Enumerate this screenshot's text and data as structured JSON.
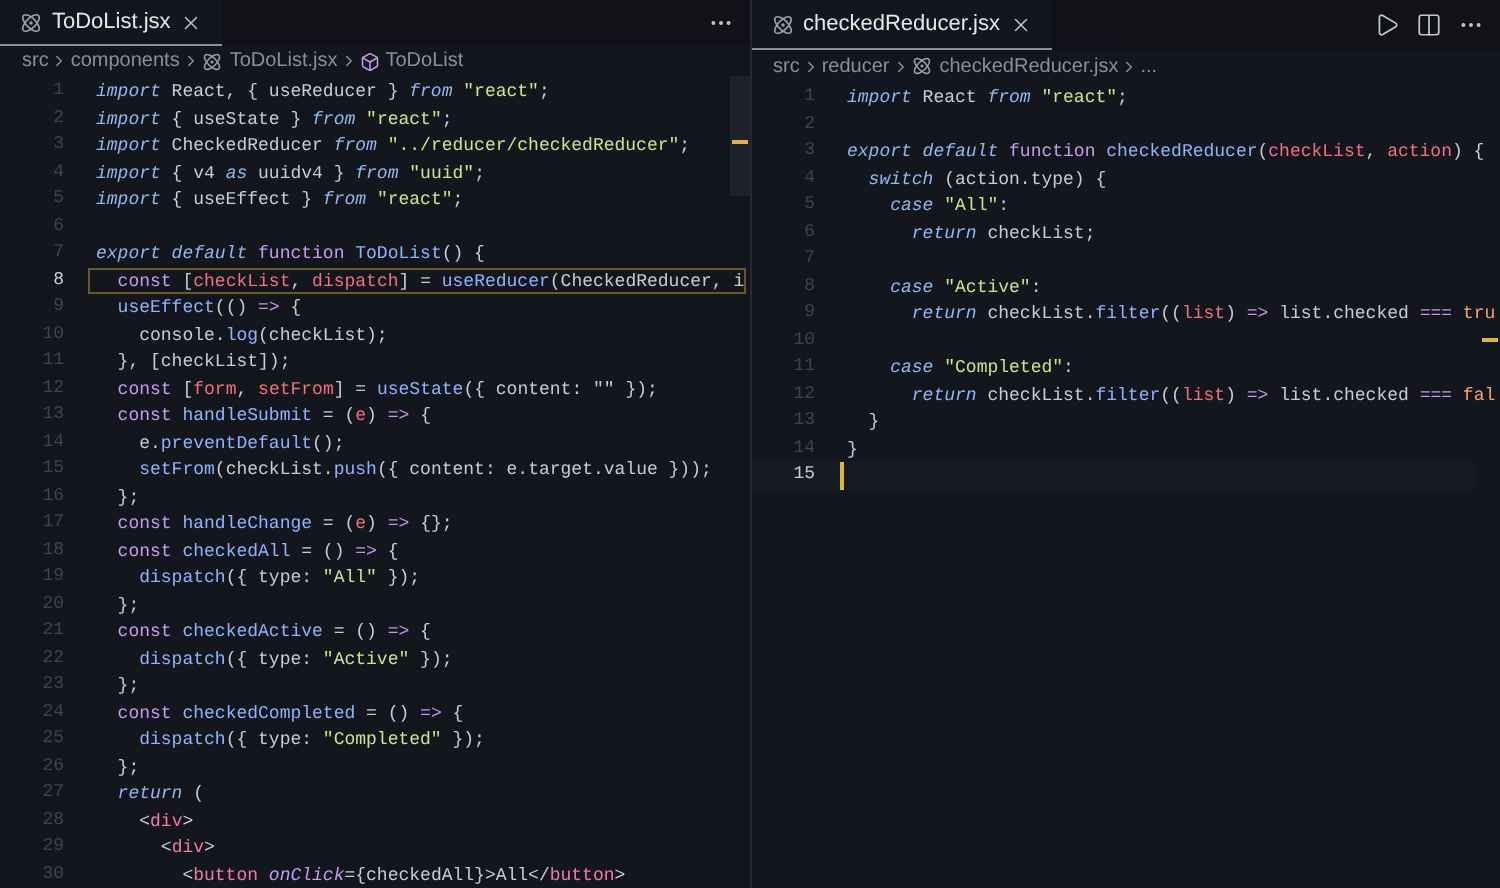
{
  "panes": [
    {
      "tab": {
        "label": "ToDoList.jsx",
        "selected": true
      },
      "breadcrumb": [
        {
          "text": "src",
          "kind": "folder"
        },
        {
          "text": "components",
          "kind": "folder"
        },
        {
          "text": "ToDoList.jsx",
          "kind": "file"
        },
        {
          "text": "ToDoList",
          "kind": "symbol"
        }
      ],
      "lines": [
        {
          "n": "1",
          "current": false,
          "tokens": [
            {
              "text": "import",
              "kind": "kw"
            },
            {
              "text": " React, { useReducer }",
              "kind": "p"
            },
            {
              "text": " from",
              "kind": "kw"
            },
            {
              "text": " \"react\"",
              "kind": "str"
            },
            {
              "text": ";",
              "kind": "p"
            }
          ]
        },
        {
          "n": "2",
          "current": false,
          "tokens": [
            {
              "text": "import",
              "kind": "kw"
            },
            {
              "text": " { useState }",
              "kind": "p"
            },
            {
              "text": " from",
              "kind": "kw"
            },
            {
              "text": " \"react\"",
              "kind": "str"
            },
            {
              "text": ";",
              "kind": "p"
            }
          ]
        },
        {
          "n": "3",
          "current": false,
          "tokens": [
            {
              "text": "import",
              "kind": "kw"
            },
            {
              "text": " CheckedReducer",
              "kind": "p"
            },
            {
              "text": " from",
              "kind": "kw"
            },
            {
              "text": " \"../reducer/checkedReducer\"",
              "kind": "str"
            },
            {
              "text": ";",
              "kind": "p"
            }
          ]
        },
        {
          "n": "4",
          "current": false,
          "tokens": [
            {
              "text": "import",
              "kind": "kw"
            },
            {
              "text": " { v4",
              "kind": "p"
            },
            {
              "text": " as",
              "kind": "kw"
            },
            {
              "text": " uuidv4 }",
              "kind": "p"
            },
            {
              "text": " from",
              "kind": "kw"
            },
            {
              "text": " \"uuid\"",
              "kind": "str"
            },
            {
              "text": ";",
              "kind": "p"
            }
          ]
        },
        {
          "n": "5",
          "current": false,
          "tokens": [
            {
              "text": "import",
              "kind": "kw"
            },
            {
              "text": " { useEffect }",
              "kind": "p"
            },
            {
              "text": " from",
              "kind": "kw"
            },
            {
              "text": " \"react\"",
              "kind": "str"
            },
            {
              "text": ";",
              "kind": "p"
            }
          ]
        },
        {
          "n": "6",
          "current": false
        },
        {
          "n": "7",
          "current": false,
          "tokens": [
            {
              "text": "export default",
              "kind": "kw"
            },
            {
              "text": " function",
              "kind": "fn"
            },
            {
              "text": " ToDoList",
              "kind": "call"
            },
            {
              "text": "() {",
              "kind": "p"
            }
          ]
        },
        {
          "n": "8",
          "current": true,
          "tokens": [
            {
              "text": "  const",
              "kind": "fn"
            },
            {
              "text": " [",
              "kind": "p"
            },
            {
              "text": "checkList",
              "kind": "var"
            },
            {
              "text": ", ",
              "kind": "p"
            },
            {
              "text": "dispatch",
              "kind": "var"
            },
            {
              "text": "] = ",
              "kind": "p"
            },
            {
              "text": "useReducer",
              "kind": "call"
            },
            {
              "text": "(CheckedReducer, i",
              "kind": "p"
            }
          ]
        },
        {
          "n": "9",
          "current": false,
          "tokens": [
            {
              "text": "  useEffect",
              "kind": "call"
            },
            {
              "text": "(() ",
              "kind": "p"
            },
            {
              "text": "=>",
              "kind": "op"
            },
            {
              "text": " {",
              "kind": "p"
            }
          ]
        },
        {
          "n": "10",
          "current": false,
          "tokens": [
            {
              "text": "    console.",
              "kind": "p"
            },
            {
              "text": "log",
              "kind": "call"
            },
            {
              "text": "(checkList);",
              "kind": "p"
            }
          ]
        },
        {
          "n": "11",
          "current": false,
          "tokens": [
            {
              "text": "  }, [checkList]);",
              "kind": "p"
            }
          ]
        },
        {
          "n": "12",
          "current": false,
          "tokens": [
            {
              "text": "  const",
              "kind": "fn"
            },
            {
              "text": " [",
              "kind": "p"
            },
            {
              "text": "form",
              "kind": "var"
            },
            {
              "text": ", ",
              "kind": "p"
            },
            {
              "text": "setFrom",
              "kind": "var"
            },
            {
              "text": "] = ",
              "kind": "p"
            },
            {
              "text": "useState",
              "kind": "call"
            },
            {
              "text": "({ content: \"\" });",
              "kind": "p"
            }
          ]
        },
        {
          "n": "13",
          "current": false,
          "tokens": [
            {
              "text": "  const",
              "kind": "fn"
            },
            {
              "text": " handleSubmit",
              "kind": "call"
            },
            {
              "text": " = (",
              "kind": "p"
            },
            {
              "text": "e",
              "kind": "var"
            },
            {
              "text": ") ",
              "kind": "p"
            },
            {
              "text": "=>",
              "kind": "op"
            },
            {
              "text": " {",
              "kind": "p"
            }
          ]
        },
        {
          "n": "14",
          "current": false,
          "tokens": [
            {
              "text": "    e.",
              "kind": "p"
            },
            {
              "text": "preventDefault",
              "kind": "call"
            },
            {
              "text": "();",
              "kind": "p"
            }
          ]
        },
        {
          "n": "15",
          "current": false,
          "tokens": [
            {
              "text": "    setFrom",
              "kind": "call"
            },
            {
              "text": "(checkList.",
              "kind": "p"
            },
            {
              "text": "push",
              "kind": "call"
            },
            {
              "text": "({ content: e.target.value }));",
              "kind": "p"
            }
          ]
        },
        {
          "n": "16",
          "current": false,
          "tokens": [
            {
              "text": "  };",
              "kind": "p"
            }
          ]
        },
        {
          "n": "17",
          "current": false,
          "tokens": [
            {
              "text": "  const",
              "kind": "fn"
            },
            {
              "text": " handleChange",
              "kind": "call"
            },
            {
              "text": " = (",
              "kind": "p"
            },
            {
              "text": "e",
              "kind": "var"
            },
            {
              "text": ") ",
              "kind": "p"
            },
            {
              "text": "=>",
              "kind": "op"
            },
            {
              "text": " {};",
              "kind": "p"
            }
          ]
        },
        {
          "n": "18",
          "current": false,
          "tokens": [
            {
              "text": "  const",
              "kind": "fn"
            },
            {
              "text": " checkedAll",
              "kind": "call"
            },
            {
              "text": " = () ",
              "kind": "p"
            },
            {
              "text": "=>",
              "kind": "op"
            },
            {
              "text": " {",
              "kind": "p"
            }
          ]
        },
        {
          "n": "19",
          "current": false,
          "tokens": [
            {
              "text": "    dispatch",
              "kind": "call"
            },
            {
              "text": "({ type: ",
              "kind": "p"
            },
            {
              "text": "\"All\"",
              "kind": "str"
            },
            {
              "text": " });",
              "kind": "p"
            }
          ]
        },
        {
          "n": "20",
          "current": false,
          "tokens": [
            {
              "text": "  };",
              "kind": "p"
            }
          ]
        },
        {
          "n": "21",
          "current": false,
          "tokens": [
            {
              "text": "  const",
              "kind": "fn"
            },
            {
              "text": " checkedActive",
              "kind": "call"
            },
            {
              "text": " = () ",
              "kind": "p"
            },
            {
              "text": "=>",
              "kind": "op"
            },
            {
              "text": " {",
              "kind": "p"
            }
          ]
        },
        {
          "n": "22",
          "current": false,
          "tokens": [
            {
              "text": "    dispatch",
              "kind": "call"
            },
            {
              "text": "({ type: ",
              "kind": "p"
            },
            {
              "text": "\"Active\"",
              "kind": "str"
            },
            {
              "text": " });",
              "kind": "p"
            }
          ]
        },
        {
          "n": "23",
          "current": false,
          "tokens": [
            {
              "text": "  };",
              "kind": "p"
            }
          ]
        },
        {
          "n": "24",
          "current": false,
          "tokens": [
            {
              "text": "  const",
              "kind": "fn"
            },
            {
              "text": " checkedCompleted",
              "kind": "call"
            },
            {
              "text": " = () ",
              "kind": "p"
            },
            {
              "text": "=>",
              "kind": "op"
            },
            {
              "text": " {",
              "kind": "p"
            }
          ]
        },
        {
          "n": "25",
          "current": false,
          "tokens": [
            {
              "text": "    dispatch",
              "kind": "call"
            },
            {
              "text": "({ type: ",
              "kind": "p"
            },
            {
              "text": "\"Completed\"",
              "kind": "str"
            },
            {
              "text": " });",
              "kind": "p"
            }
          ]
        },
        {
          "n": "26",
          "current": false,
          "tokens": [
            {
              "text": "  };",
              "kind": "p"
            }
          ]
        },
        {
          "n": "27",
          "current": false,
          "tokens": [
            {
              "text": "  return",
              "kind": "kw"
            },
            {
              "text": " (",
              "kind": "p"
            }
          ]
        },
        {
          "n": "28",
          "current": false,
          "tokens": [
            {
              "text": "    <",
              "kind": "p"
            },
            {
              "text": "div",
              "kind": "tag"
            },
            {
              "text": ">",
              "kind": "p"
            }
          ]
        },
        {
          "n": "29",
          "current": false,
          "tokens": [
            {
              "text": "      <",
              "kind": "p"
            },
            {
              "text": "div",
              "kind": "tag"
            },
            {
              "text": ">",
              "kind": "p"
            }
          ]
        },
        {
          "n": "30",
          "current": false,
          "tokens": [
            {
              "text": "        <",
              "kind": "p"
            },
            {
              "text": "button",
              "kind": "tag"
            },
            {
              "text": " onClick",
              "kind": "attr"
            },
            {
              "text": "={checkedAll}>All</",
              "kind": "p"
            },
            {
              "text": "button",
              "kind": "tag"
            },
            {
              "text": ">",
              "kind": "p"
            }
          ]
        }
      ]
    },
    {
      "tab": {
        "label": "checkedReducer.jsx",
        "selected": true
      },
      "breadcrumb": [
        {
          "text": "src",
          "kind": "folder"
        },
        {
          "text": "reducer",
          "kind": "folder"
        },
        {
          "text": "checkedReducer.jsx",
          "kind": "file"
        },
        {
          "text": "...",
          "kind": "more"
        }
      ],
      "lines": [
        {
          "n": "1",
          "current": false,
          "tokens": [
            {
              "text": "import",
              "kind": "kw"
            },
            {
              "text": " React",
              "kind": "p"
            },
            {
              "text": " from",
              "kind": "kw"
            },
            {
              "text": " \"react\"",
              "kind": "str"
            },
            {
              "text": ";",
              "kind": "p"
            }
          ]
        },
        {
          "n": "2",
          "current": false
        },
        {
          "n": "3",
          "current": false,
          "tokens": [
            {
              "text": "export default",
              "kind": "kw"
            },
            {
              "text": " function",
              "kind": "fn"
            },
            {
              "text": " checkedReducer",
              "kind": "call"
            },
            {
              "text": "(",
              "kind": "p"
            },
            {
              "text": "checkList",
              "kind": "var"
            },
            {
              "text": ", ",
              "kind": "p"
            },
            {
              "text": "action",
              "kind": "var"
            },
            {
              "text": ") {",
              "kind": "p"
            }
          ]
        },
        {
          "n": "4",
          "current": false,
          "tokens": [
            {
              "text": "  switch",
              "kind": "kw"
            },
            {
              "text": " (action.type) {",
              "kind": "p"
            }
          ]
        },
        {
          "n": "5",
          "current": false,
          "tokens": [
            {
              "text": "    case",
              "kind": "kw"
            },
            {
              "text": " \"All\"",
              "kind": "str"
            },
            {
              "text": ":",
              "kind": "p"
            }
          ]
        },
        {
          "n": "6",
          "current": false,
          "tokens": [
            {
              "text": "      return",
              "kind": "kw"
            },
            {
              "text": " checkList;",
              "kind": "p"
            }
          ]
        },
        {
          "n": "7",
          "current": false
        },
        {
          "n": "8",
          "current": false,
          "tokens": [
            {
              "text": "    case",
              "kind": "kw"
            },
            {
              "text": " \"Active\"",
              "kind": "str"
            },
            {
              "text": ":",
              "kind": "p"
            }
          ]
        },
        {
          "n": "9",
          "current": false,
          "tokens": [
            {
              "text": "      return",
              "kind": "kw"
            },
            {
              "text": " checkList.",
              "kind": "p"
            },
            {
              "text": "filter",
              "kind": "call"
            },
            {
              "text": "((",
              "kind": "p"
            },
            {
              "text": "list",
              "kind": "var"
            },
            {
              "text": ") ",
              "kind": "p"
            },
            {
              "text": "=>",
              "kind": "op"
            },
            {
              "text": " list.checked ",
              "kind": "p"
            },
            {
              "text": "===",
              "kind": "op"
            },
            {
              "text": " tru",
              "kind": "bool"
            }
          ]
        },
        {
          "n": "10",
          "current": false
        },
        {
          "n": "11",
          "current": false,
          "tokens": [
            {
              "text": "    case",
              "kind": "kw"
            },
            {
              "text": " \"Completed\"",
              "kind": "str"
            },
            {
              "text": ":",
              "kind": "p"
            }
          ]
        },
        {
          "n": "12",
          "current": false,
          "tokens": [
            {
              "text": "      return",
              "kind": "kw"
            },
            {
              "text": " checkList.",
              "kind": "p"
            },
            {
              "text": "filter",
              "kind": "call"
            },
            {
              "text": "((",
              "kind": "p"
            },
            {
              "text": "list",
              "kind": "var"
            },
            {
              "text": ") ",
              "kind": "p"
            },
            {
              "text": "=>",
              "kind": "op"
            },
            {
              "text": " list.checked ",
              "kind": "p"
            },
            {
              "text": "===",
              "kind": "op"
            },
            {
              "text": " fal",
              "kind": "bool"
            }
          ]
        },
        {
          "n": "13",
          "current": false,
          "tokens": [
            {
              "text": "  }",
              "kind": "p"
            }
          ]
        },
        {
          "n": "14",
          "current": false,
          "tokens": [
            {
              "text": "}",
              "kind": "p"
            }
          ]
        },
        {
          "n": "15",
          "current": true
        }
      ]
    }
  ]
}
